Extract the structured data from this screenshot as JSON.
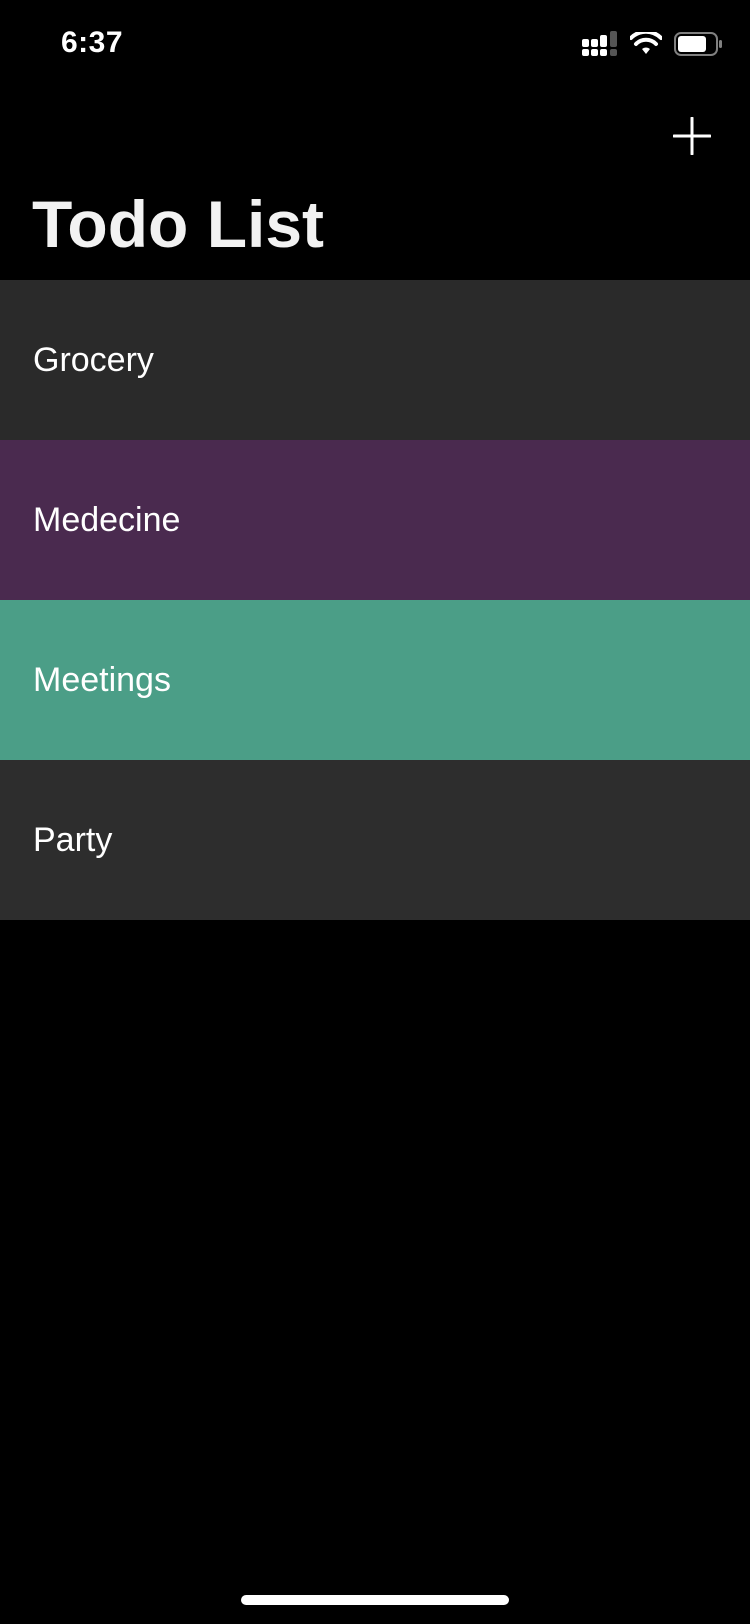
{
  "status_bar": {
    "time": "6:37",
    "icons": [
      "cellular-signal-icon",
      "wifi-icon",
      "battery-icon"
    ]
  },
  "nav": {
    "title": "Todo List",
    "add_icon": "plus-icon"
  },
  "todo_items": [
    {
      "label": "Grocery",
      "color": "#2a2a2a"
    },
    {
      "label": "Medecine",
      "color": "#4a2a4f"
    },
    {
      "label": "Meetings",
      "color": "#4b9e87"
    },
    {
      "label": "Party",
      "color": "#2d2d2d"
    }
  ],
  "colors": {
    "background": "#000000",
    "text": "#ffffff"
  }
}
